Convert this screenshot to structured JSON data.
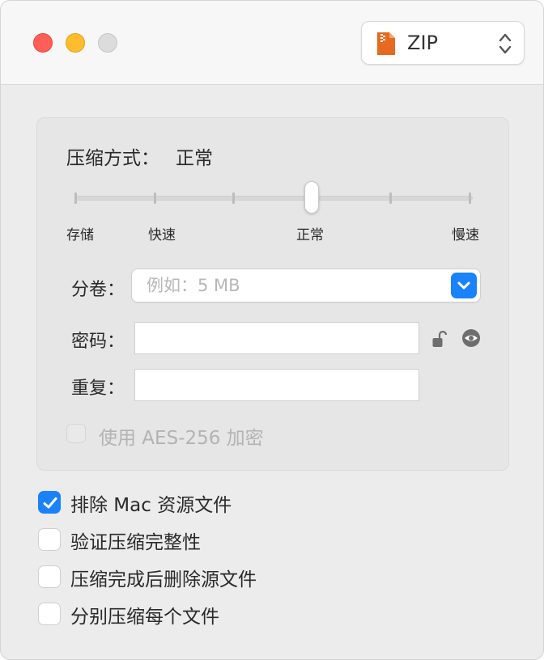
{
  "titlebar": {
    "format": {
      "label": "ZIP",
      "icon": "zip-file-icon",
      "icon_color": "#e66a1f"
    }
  },
  "compression": {
    "method_label": "压缩方式：",
    "method_value": "正常",
    "levels": [
      "存储",
      "快速",
      "正常",
      "慢速"
    ]
  },
  "split": {
    "label": "分卷：",
    "placeholder": "例如：5 MB",
    "value": ""
  },
  "password": {
    "label": "密码：",
    "value": ""
  },
  "repeat": {
    "label": "重复：",
    "value": ""
  },
  "aes": {
    "label": "使用 AES-256 加密",
    "checked": false,
    "enabled": false
  },
  "options": [
    {
      "label": "排除 Mac 资源文件",
      "checked": true
    },
    {
      "label": "验证压缩完整性",
      "checked": false
    },
    {
      "label": "压缩完成后删除源文件",
      "checked": false
    },
    {
      "label": "分别压缩每个文件",
      "checked": false
    }
  ],
  "colors": {
    "accent": "#1a82fb",
    "close": "#ff5f57",
    "minimize": "#febc2e",
    "zoom_disabled": "#dcdcdc"
  }
}
